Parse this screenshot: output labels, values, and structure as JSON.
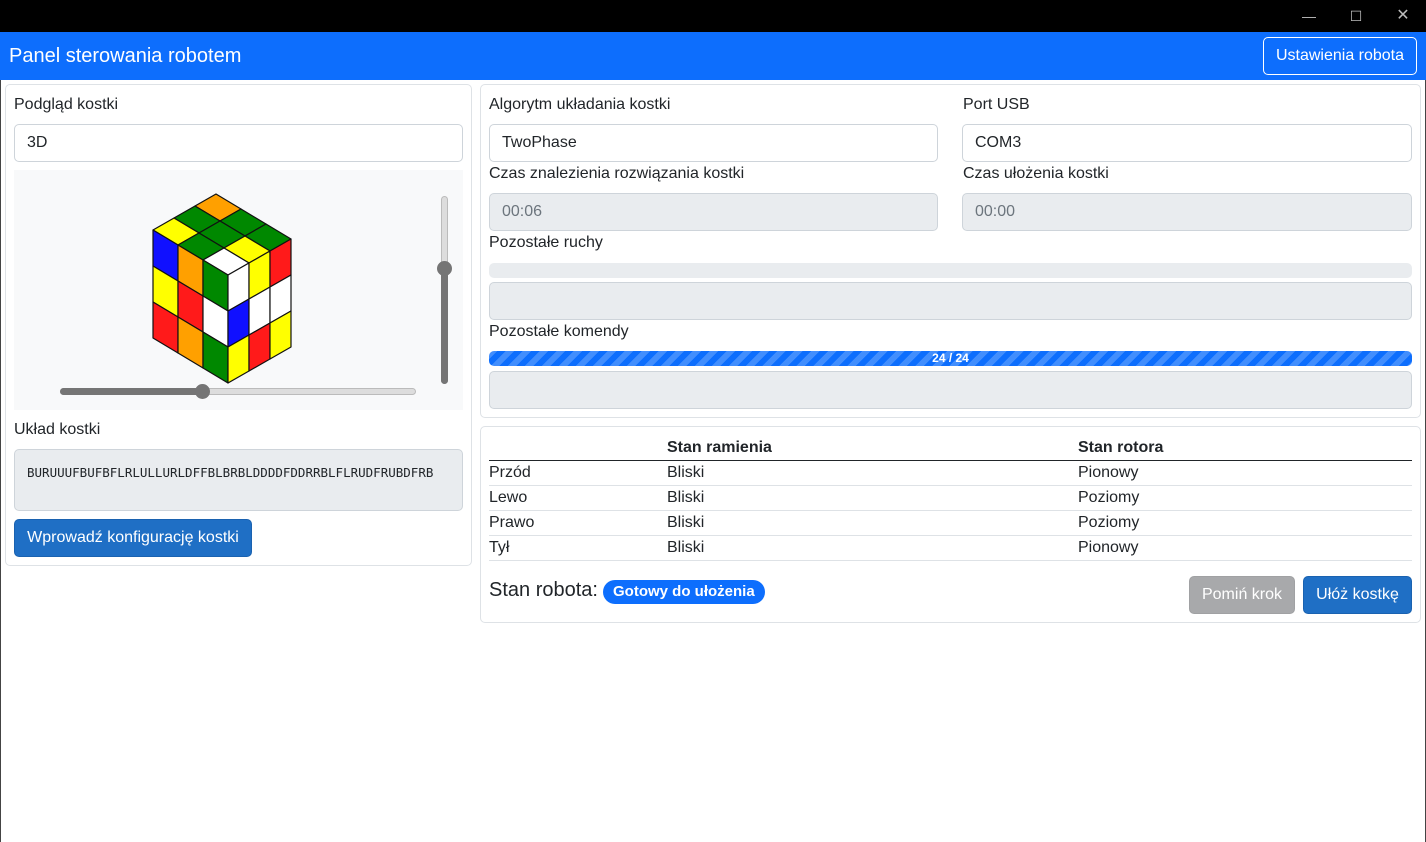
{
  "window": {
    "min_icon": "—",
    "max_icon": "☐",
    "close_icon": "✕"
  },
  "navbar": {
    "title": "Panel sterowania robotem",
    "settings_button": "Ustawienia robota"
  },
  "preview": {
    "label": "Podgląd kostki",
    "mode_value": "3D",
    "zoom_level": 0.4,
    "rotation_level": 0.62
  },
  "layout_section": {
    "label": "Układ kostki",
    "cube_string": "BURUUUFBUFBFLRLULLURLDFFBLBRBLDDDDFDDRRBLFLRUDFRUBDFRB",
    "enter_button": "Wprowadź konfigurację kostki"
  },
  "solver": {
    "algorithm_label": "Algorytm układania kostki",
    "algorithm_value": "TwoPhase",
    "port_label": "Port USB",
    "port_value": "COM3",
    "find_time_label": "Czas znalezienia rozwiązania kostki",
    "find_time_value": "00:06",
    "solve_time_label": "Czas ułożenia kostki",
    "solve_time_value": "00:00",
    "moves_label": "Pozostałe ruchy",
    "moves_progress": 0,
    "commands_label": "Pozostałe komendy",
    "commands_progress_text": "24 / 24",
    "commands_progress": 1.0
  },
  "table": {
    "headers": [
      "",
      "Stan ramienia",
      "Stan rotora"
    ],
    "rows": [
      [
        "Przód",
        "Bliski",
        "Pionowy"
      ],
      [
        "Lewo",
        "Bliski",
        "Poziomy"
      ],
      [
        "Prawo",
        "Bliski",
        "Poziomy"
      ],
      [
        "Tył",
        "Bliski",
        "Pionowy"
      ]
    ]
  },
  "robot": {
    "status_label": "Stan robota:",
    "status_badge": "Gotowy do ułożenia",
    "skip_button": "Pomiń krok",
    "solve_button": "Ułóż kostkę"
  },
  "colors": {
    "accent": "#0d6efd",
    "button_primary": "#1f6fc5",
    "button_disabled": "#a8a9ab"
  }
}
